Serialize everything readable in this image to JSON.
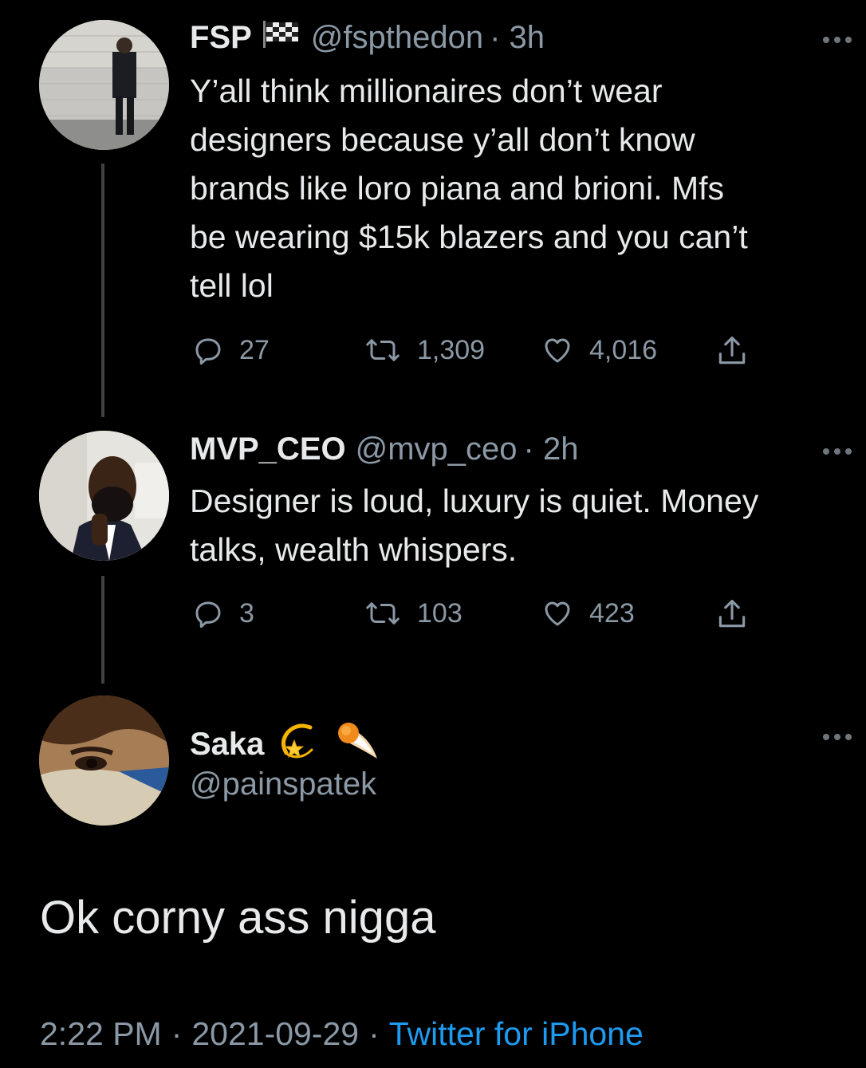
{
  "tweets": [
    {
      "display_name": "FSP",
      "badge_icon": "checkered-flag-icon",
      "handle": "@fspthedon",
      "time": "· 3h",
      "text_lines": [
        "Y’all think millionaires don’t wear",
        "designers because y’all don’t know",
        "brands like loro piana and brioni. Mfs",
        "be wearing $15k blazers and you can’t",
        "tell lol"
      ],
      "replies": "27",
      "retweets": "1,309",
      "likes": "4,016"
    },
    {
      "display_name": "MVP_CEO",
      "handle": "@mvp_ceo",
      "time": "· 2h",
      "text_lines": [
        "Designer is loud, luxury is quiet. Money",
        "talks, wealth whispers."
      ],
      "replies": "3",
      "retweets": "103",
      "likes": "423"
    }
  ],
  "main_tweet": {
    "display_name": "Saka",
    "emoji_icons": [
      "dizzy-star-icon",
      "comet-icon"
    ],
    "handle": "@painspatek",
    "text": "Ok corny ass nigga",
    "time": "2:22 PM",
    "separator": "·",
    "date": "2021-09-29",
    "source": "Twitter for iPhone"
  },
  "colors": {
    "background": "#000000",
    "text": "#e7e9ea",
    "muted": "#8b98a5",
    "link": "#1d9bf0"
  }
}
